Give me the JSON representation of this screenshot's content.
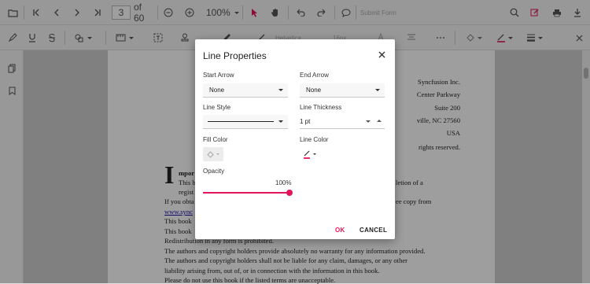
{
  "toolbar": {
    "page_number": "3",
    "page_count": "of 60",
    "zoom": "100%",
    "submit_form": "Submit Form",
    "font_family": "Helvetica",
    "font_size": "16px"
  },
  "page_text": {
    "right_lines": [
      "Syncfusion Inc.",
      "Center Parkway",
      "Suite 200",
      "ville, NC 27560",
      "USA",
      "rights reserved."
    ],
    "drop_cap": "I",
    "important_fragment": "mpor",
    "body_lines": [
      "This b",
      "regist",
      "If you obta",
      "www.sync",
      "This book",
      "This book",
      "Redistribution in any form is prohibited.",
      "The authors and copyright holders provide absolutely no warranty for any information provided.",
      "The authors and copyright holders shall not be liable for any claim, damages, or any other",
      "liability arising from, out of, or in connection with the information in this book.",
      "Please do not use this book if the listed terms are unacceptable."
    ],
    "right_fragments": [
      "letion of a",
      "ee copy from"
    ]
  },
  "dialog": {
    "title": "Line Properties",
    "start_arrow_label": "Start Arrow",
    "start_arrow_value": "None",
    "end_arrow_label": "End Arrow",
    "end_arrow_value": "None",
    "line_style_label": "Line Style",
    "line_thickness_label": "Line Thickness",
    "line_thickness_value": "1 pt",
    "fill_color_label": "Fill Color",
    "line_color_label": "Line Color",
    "opacity_label": "Opacity",
    "opacity_value": "100%",
    "opacity_fraction": 1.0,
    "ok_label": "OK",
    "cancel_label": "CANCEL"
  },
  "colors": {
    "accent": "#e3165b",
    "line_color": "#e3165b"
  }
}
